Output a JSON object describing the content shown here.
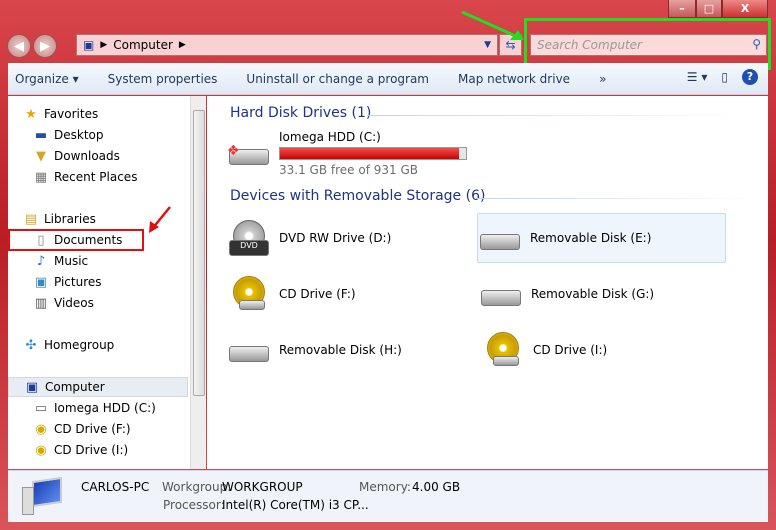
{
  "window": {
    "minimize": "–",
    "maximize": "□",
    "close": "X"
  },
  "address": {
    "path": "Computer"
  },
  "search": {
    "placeholder": "Search Computer"
  },
  "toolbar": {
    "organize": "Organize ▾",
    "system_properties": "System properties",
    "uninstall": "Uninstall or change a program",
    "map_drive": "Map network drive",
    "more": "»"
  },
  "sidebar": {
    "favorites": "Favorites",
    "desktop": "Desktop",
    "downloads": "Downloads",
    "recent": "Recent Places",
    "libraries": "Libraries",
    "documents": "Documents",
    "music": "Music",
    "pictures": "Pictures",
    "videos": "Videos",
    "homegroup": "Homegroup",
    "computer": "Computer",
    "c": "Iomega HDD (C:)",
    "f": "CD Drive (F:)",
    "i": "CD Drive (I:)"
  },
  "content": {
    "hdd_header": "Hard Disk Drives (1)",
    "hdd": {
      "name": "Iomega HDD (C:)",
      "free": "33.1 GB free of 931 GB",
      "used_fraction": 0.964,
      "bar_color": "#d8161c"
    },
    "removable_header": "Devices with Removable Storage (6)",
    "devices": [
      "DVD RW Drive (D:)",
      "Removable Disk (E:)",
      "CD Drive (F:)",
      "Removable Disk (G:)",
      "Removable Disk (H:)",
      "CD Drive (I:)"
    ]
  },
  "details": {
    "pc_name": "CARLOS-PC",
    "workgroup_label": "Workgroup:",
    "workgroup": "WORKGROUP",
    "memory_label": "Memory:",
    "memory": "4.00 GB",
    "processor_label": "Processor:",
    "processor": "Intel(R) Core(TM) i3 CP..."
  },
  "annotations": {
    "highlight_green": "#22dd22",
    "highlight_red": "#e01010"
  }
}
